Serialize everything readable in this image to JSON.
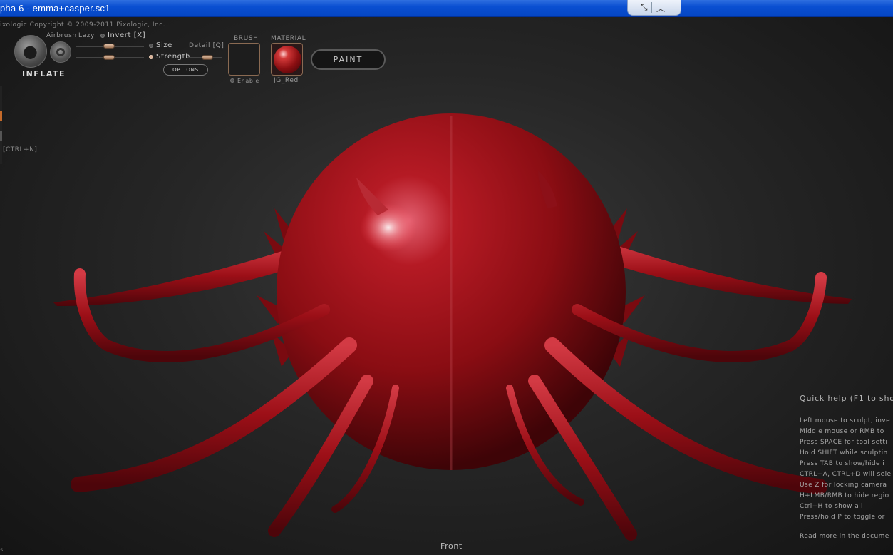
{
  "window": {
    "title": "pha 6 - emma+casper.sc1",
    "restore_icon": "restore-icon",
    "pin_icon": "chevron-up-icon"
  },
  "app": {
    "copyright": "ixologic   Copyright © 2009-2011 Pixologic, Inc."
  },
  "brush": {
    "name": "INFLATE",
    "airbrush_label": "Airbrush",
    "lazy_label": "Lazy",
    "invert_label": "Invert [X]",
    "size_label": "Size",
    "detail_label": "Detail [Q]",
    "strength_label": "Strength",
    "options_label": "OPTIONS"
  },
  "stamp": {
    "header": "BRUSH",
    "enable_label": "Enable"
  },
  "material": {
    "header": "MATERIAL",
    "name": "JG_Red"
  },
  "paint_button": "PAINT",
  "left_panel": {
    "shortcut_label": "[CTRL+N]"
  },
  "quick_help": {
    "title": "Quick help (F1 to show",
    "lines": [
      "Left mouse to sculpt, inve",
      "Middle mouse or RMB to",
      "Press SPACE for tool setti",
      "Hold SHIFT while sculptin",
      "Press TAB to show/hide i",
      "CTRL+A, CTRL+D will sele",
      "Use Z for locking camera",
      "H+LMB/RMB to hide regio",
      "Ctrl+H to show all",
      "Press/hold P to toggle or"
    ],
    "more": "Read more in the docume"
  },
  "viewport": {
    "view_name": "Front",
    "bottom_left": "s"
  },
  "colors": {
    "titlebar": "#0546c4",
    "model_red": "#9e0f16",
    "accent_knob": "#d9b39a"
  }
}
